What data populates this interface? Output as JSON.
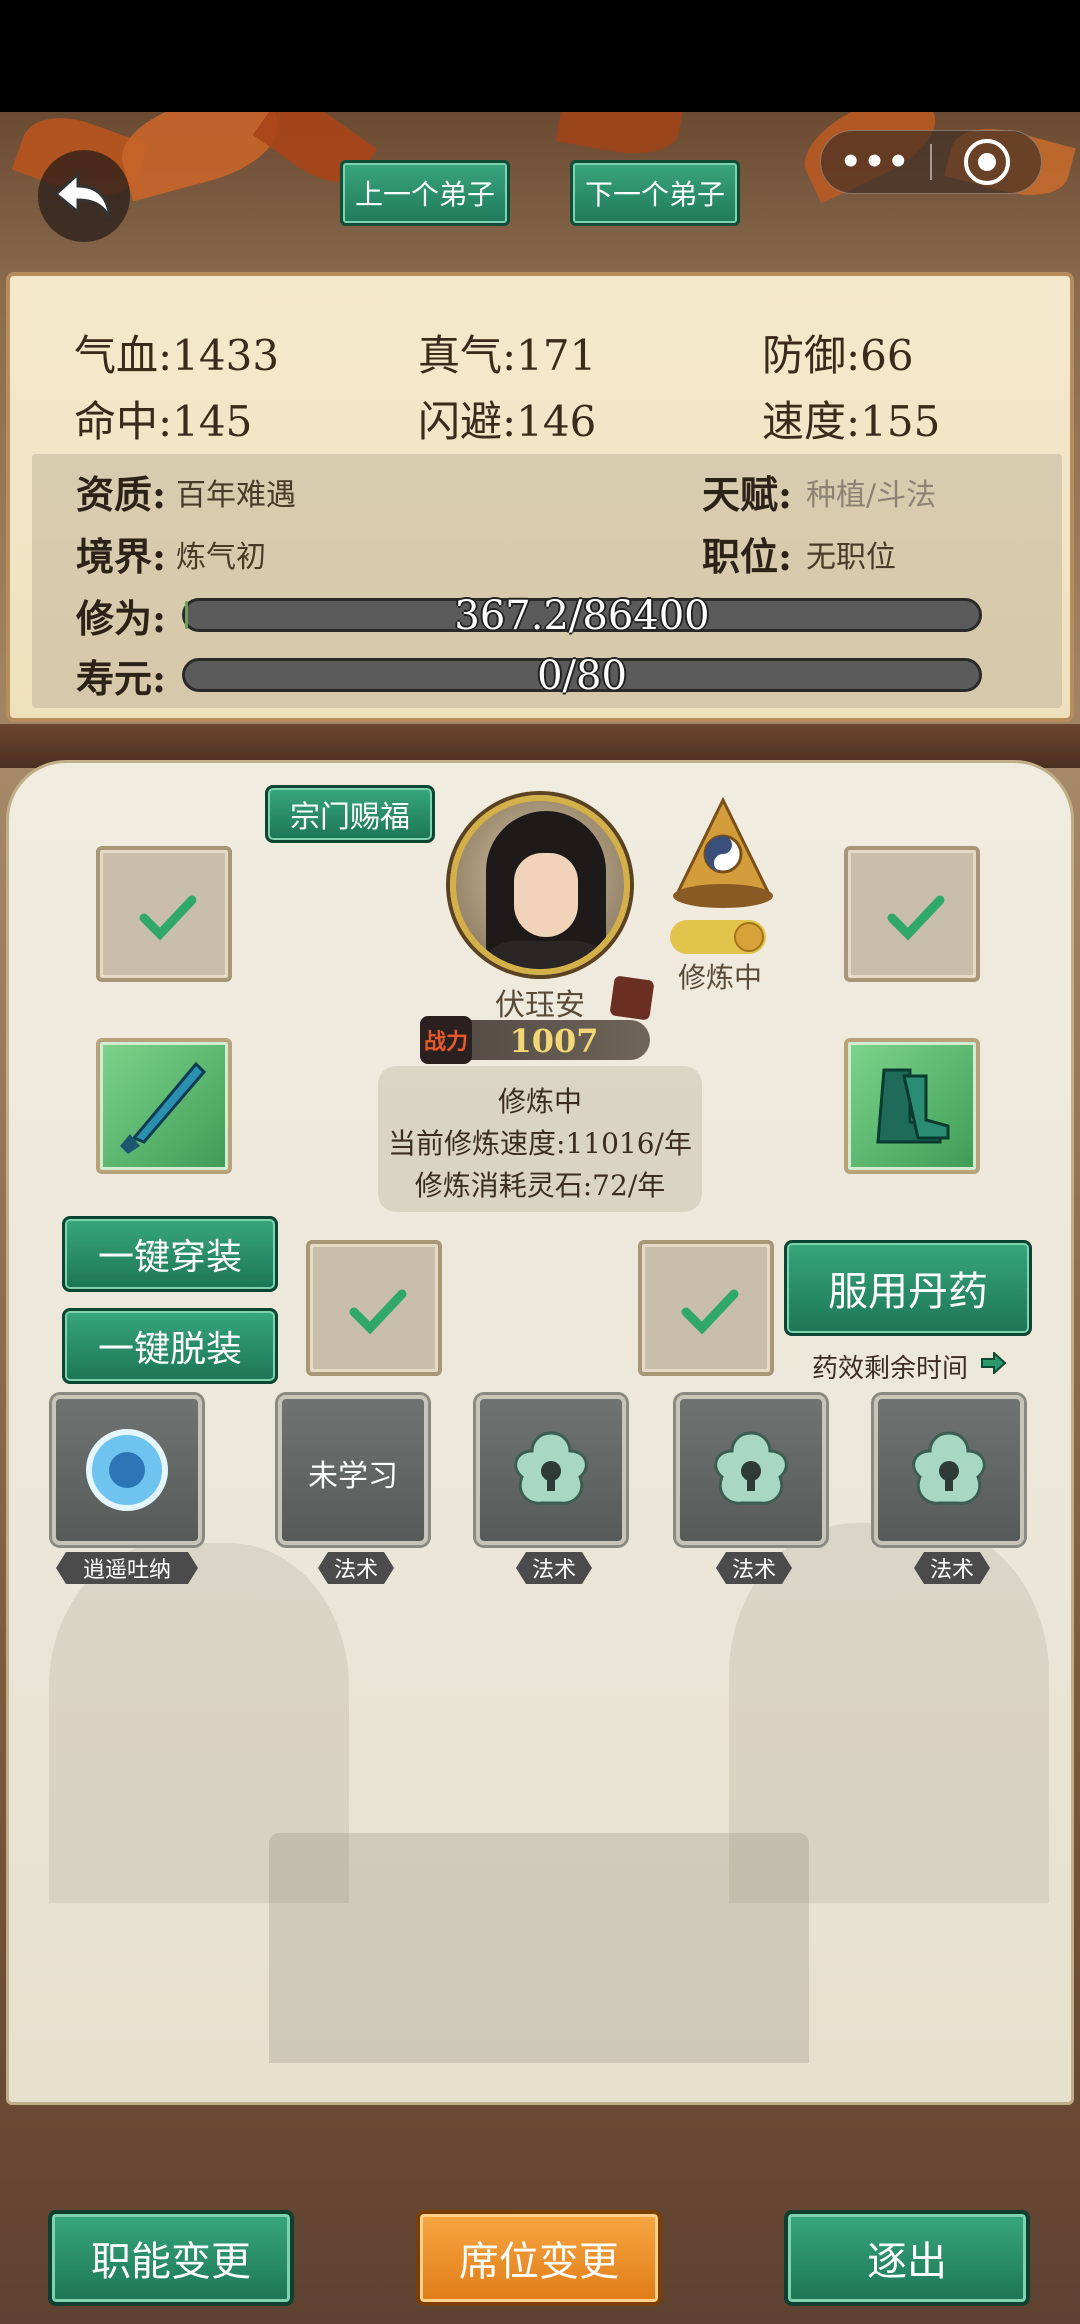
{
  "nav": {
    "prev_label": "上一个弟子",
    "next_label": "下一个弟子",
    "more_label": "•••"
  },
  "stats": {
    "hp": "气血:1433",
    "qi": "真气:171",
    "defense": "防御:66",
    "hit": "命中:145",
    "dodge": "闪避:146",
    "speed": "速度:155"
  },
  "info": {
    "aptitude_label": "资质:",
    "aptitude_value": "百年难遇",
    "talent_label": "天赋:",
    "talent_value": "种植/斗法",
    "realm_label": "境界:",
    "realm_value": "炼气初",
    "position_label": "职位:",
    "position_value": "无职位",
    "cultivation_label": "修为:",
    "cultivation_text": "367.2/86400",
    "cultivation_progress": 0.00425,
    "lifespan_label": "寿元:",
    "lifespan_text": "0/80",
    "lifespan_progress": 0.0
  },
  "disciple": {
    "blessing_label": "宗门赐福",
    "name": "伏珏安",
    "power_badge": "战力",
    "power": "1007",
    "state_label": "修炼中"
  },
  "status": {
    "line1": "修炼中",
    "line2": "当前修炼速度:11016/年",
    "line3": "修炼消耗灵石:72/年"
  },
  "actions": {
    "equip_all": "一键穿装",
    "unequip_all": "一键脱装",
    "take_pill": "服用丹药",
    "pill_timer": "药效剩余时间"
  },
  "skills": [
    {
      "label": "逍遥吐纳",
      "content": ""
    },
    {
      "label": "法术",
      "content": "未学习"
    },
    {
      "label": "法术",
      "content": ""
    },
    {
      "label": "法术",
      "content": ""
    },
    {
      "label": "法术",
      "content": ""
    }
  ],
  "bottom": {
    "role_change": "职能变更",
    "seat_change": "席位变更",
    "expel": "逐出"
  },
  "colors": {
    "green_button": "#1f7a58",
    "orange_button": "#e98a22",
    "panel": "#f5e9cd"
  }
}
